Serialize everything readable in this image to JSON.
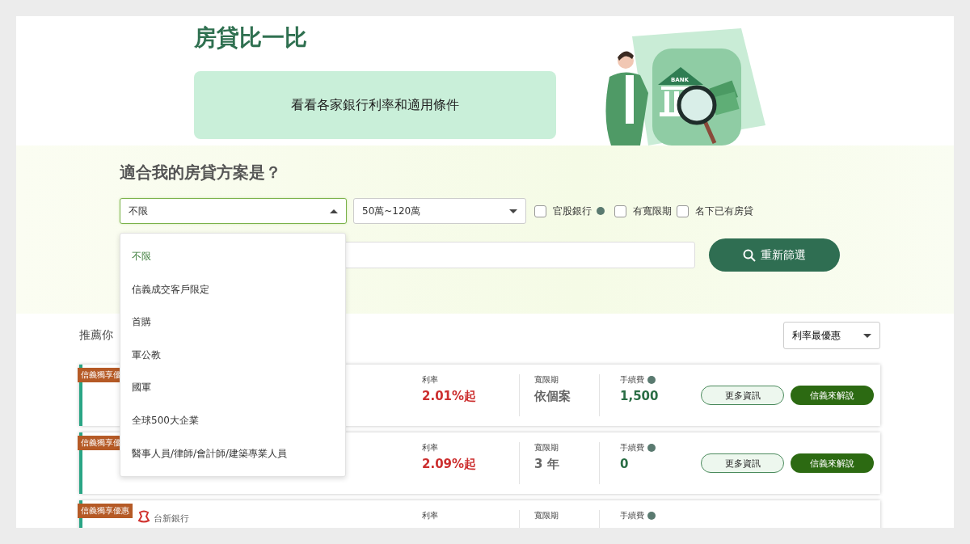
{
  "hero": {
    "title": "房貸比一比",
    "bubble": "看看各家銀行利率和適用條件",
    "sign": "BANK"
  },
  "filters": {
    "heading": "適合我的房貸方案是？",
    "selects": [
      {
        "value": "不限",
        "expanded": true
      },
      {
        "value": "50萬~120萬",
        "expanded": false
      }
    ],
    "checkboxes": [
      {
        "label": "官股銀行",
        "checked": false,
        "info": true
      },
      {
        "label": "有寬限期",
        "checked": false,
        "info": false
      },
      {
        "label": "名下已有房貸",
        "checked": false,
        "info": false
      }
    ],
    "search_button": "重新篩選"
  },
  "dropdown": [
    {
      "label": "不限",
      "selected": true
    },
    {
      "label": "信義成交客戶限定",
      "selected": false
    },
    {
      "label": "首購",
      "selected": false
    },
    {
      "label": "軍公教",
      "selected": false
    },
    {
      "label": "國軍",
      "selected": false
    },
    {
      "label": "全球500大企業",
      "selected": false
    },
    {
      "label": "醫事人員/律師/會計師/建築專業人員",
      "selected": false
    }
  ],
  "results": {
    "heading": "推薦你",
    "sort": "利率最優惠",
    "cards": [
      {
        "ribbon": "信義獨享優",
        "rate_label": "利率",
        "rate": "2.01%起",
        "grace_label": "寬限期",
        "grace": "依個案",
        "fee_label": "手續費",
        "fee": "1,500",
        "buttons": [
          "更多資訊",
          "信義來解說"
        ]
      },
      {
        "ribbon": "信義獨享優",
        "rate_label": "利率",
        "rate": "2.09%起",
        "grace_label": "寬限期",
        "grace": "3 年",
        "fee_label": "手續費",
        "fee": "0",
        "buttons": [
          "更多資訊",
          "信義來解說"
        ]
      },
      {
        "ribbon": "信義獨享優惠",
        "bank": "台新銀行",
        "rate_label": "利率",
        "grace_label": "寬限期",
        "fee_label": "手續費"
      }
    ]
  }
}
